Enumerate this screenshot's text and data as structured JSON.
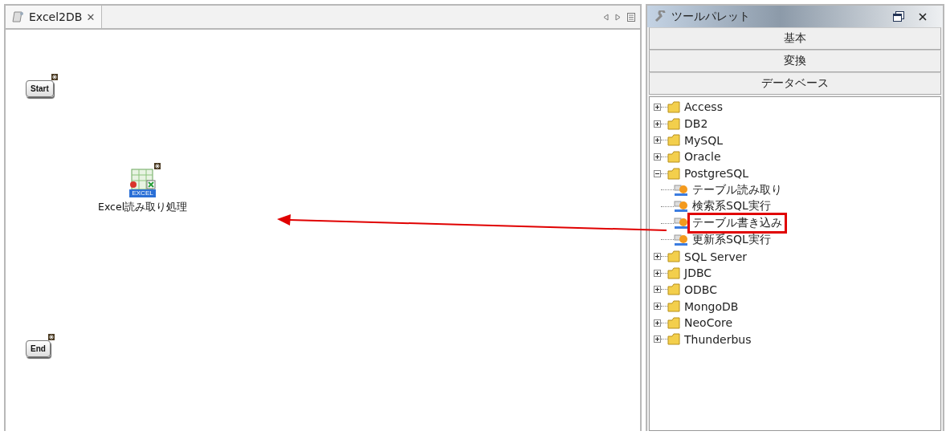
{
  "editor": {
    "tab": {
      "title": "Excel2DB",
      "close": "✕",
      "selected": true
    },
    "nodes": [
      {
        "kind": "terminal",
        "label": "Start"
      },
      {
        "kind": "excel",
        "label": "Excel読み取り処理",
        "icon_label": "EXCEL"
      },
      {
        "kind": "terminal",
        "label": "End"
      }
    ]
  },
  "palette": {
    "title": "ツールパレット",
    "sections": [
      "基本",
      "変換",
      "データベース"
    ],
    "tree": [
      {
        "label": "Access",
        "expanded": false
      },
      {
        "label": "DB2",
        "expanded": false
      },
      {
        "label": "MySQL",
        "expanded": false
      },
      {
        "label": "Oracle",
        "expanded": false
      },
      {
        "label": "PostgreSQL",
        "expanded": true,
        "children": [
          {
            "label": "テーブル読み取り",
            "highlighted": false
          },
          {
            "label": "検索系SQL実行",
            "highlighted": false
          },
          {
            "label": "テーブル書き込み",
            "highlighted": true
          },
          {
            "label": "更新系SQL実行",
            "highlighted": false
          }
        ]
      },
      {
        "label": "SQL Server",
        "expanded": false
      },
      {
        "label": "JDBC",
        "expanded": false
      },
      {
        "label": "ODBC",
        "expanded": false
      },
      {
        "label": "MongoDB",
        "expanded": false
      },
      {
        "label": "NeoCore",
        "expanded": false
      },
      {
        "label": "Thunderbus",
        "expanded": false
      }
    ]
  }
}
